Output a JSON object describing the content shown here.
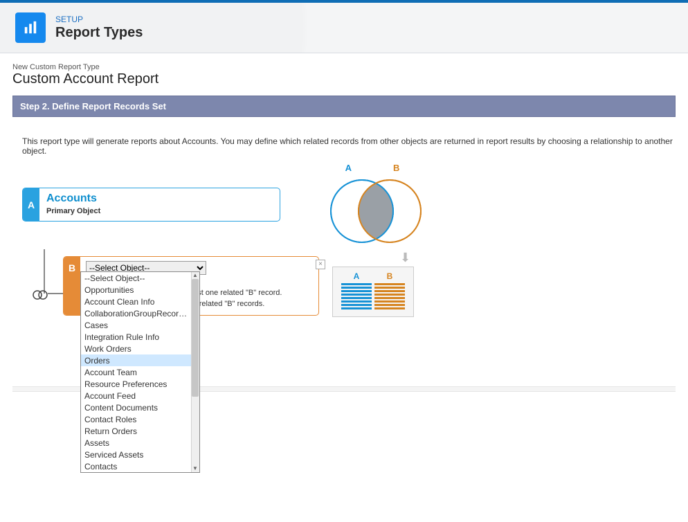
{
  "header": {
    "setup_label": "SETUP",
    "title": "Report Types"
  },
  "breadcrumb": "New Custom Report Type",
  "page_subtitle": "Custom Account Report",
  "step_banner": "Step 2. Define Report Records Set",
  "description": "This report type will generate reports about Accounts. You may define which related records from other objects are returned in report results by choosing a relationship to another object.",
  "object_a": {
    "letter": "A",
    "name": "Accounts",
    "subtitle": "Primary Object"
  },
  "object_b": {
    "letter": "B",
    "select_placeholder": "--Select Object--",
    "relation_text_1": "st one related \"B\" record.",
    "relation_text_2": " related \"B\" records."
  },
  "venn": {
    "a_label": "A",
    "b_label": "B",
    "table_a": "A",
    "table_b": "B"
  },
  "dropdown_options": [
    "--Select Object--",
    "Opportunities",
    "Account Clean Info",
    "CollaborationGroupRecord-…",
    "Cases",
    "Integration Rule Info",
    "Work Orders",
    "Orders",
    "Account Team",
    "Resource Preferences",
    "Account Feed",
    "Content Documents",
    "Contact Roles",
    "Return Orders",
    "Assets",
    "Serviced Assets",
    "Contacts"
  ],
  "dropdown_highlight_index": 7
}
